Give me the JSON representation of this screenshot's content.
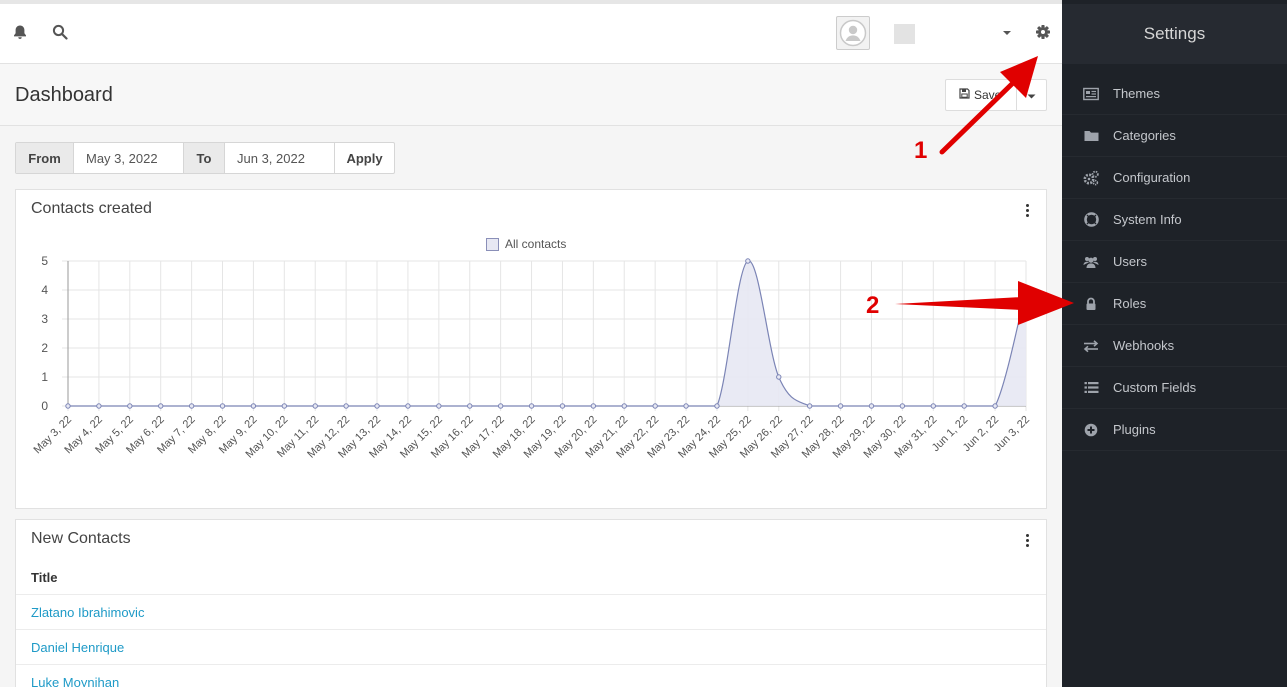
{
  "header": {
    "page_title": "Dashboard",
    "save_label": "Save"
  },
  "date_filter": {
    "from_label": "From",
    "from_value": "May 3, 2022",
    "to_label": "To",
    "to_value": "Jun 3, 2022",
    "apply_label": "Apply"
  },
  "contacts_panel": {
    "title": "Contacts created"
  },
  "chart_data": {
    "type": "area",
    "legend_position": "top-center",
    "grid": true,
    "ylim": [
      0,
      5
    ],
    "yticks": [
      0,
      1,
      2,
      3,
      4,
      5
    ],
    "series": [
      {
        "name": "All contacts",
        "color": "#7b84b5",
        "fill": "#e7e8f3",
        "values": [
          0,
          0,
          0,
          0,
          0,
          0,
          0,
          0,
          0,
          0,
          0,
          0,
          0,
          0,
          0,
          0,
          0,
          0,
          0,
          0,
          0,
          0,
          5,
          1,
          0,
          0,
          0,
          0,
          0,
          0,
          0,
          4
        ]
      }
    ],
    "categories": [
      "May 3, 22",
      "May 4, 22",
      "May 5, 22",
      "May 6, 22",
      "May 7, 22",
      "May 8, 22",
      "May 9, 22",
      "May 10, 22",
      "May 11, 22",
      "May 12, 22",
      "May 13, 22",
      "May 14, 22",
      "May 15, 22",
      "May 16, 22",
      "May 17, 22",
      "May 18, 22",
      "May 19, 22",
      "May 20, 22",
      "May 21, 22",
      "May 22, 22",
      "May 23, 22",
      "May 24, 22",
      "May 25, 22",
      "May 26, 22",
      "May 27, 22",
      "May 28, 22",
      "May 29, 22",
      "May 30, 22",
      "May 31, 22",
      "Jun 1, 22",
      "Jun 2, 22",
      "Jun 3, 22"
    ]
  },
  "new_contacts": {
    "title": "New Contacts",
    "column": "Title",
    "rows": [
      "Zlatano Ibrahimovic",
      "Daniel Henrique",
      "Luke Moynihan"
    ]
  },
  "sidebar": {
    "title": "Settings",
    "items": [
      {
        "label": "Themes",
        "icon": "themes-icon"
      },
      {
        "label": "Categories",
        "icon": "folder-icon"
      },
      {
        "label": "Configuration",
        "icon": "cogs-icon"
      },
      {
        "label": "System Info",
        "icon": "lifebuoy-icon"
      },
      {
        "label": "Users",
        "icon": "users-icon"
      },
      {
        "label": "Roles",
        "icon": "lock-icon"
      },
      {
        "label": "Webhooks",
        "icon": "exchange-icon"
      },
      {
        "label": "Custom Fields",
        "icon": "list-icon"
      },
      {
        "label": "Plugins",
        "icon": "plus-circle-icon"
      }
    ]
  },
  "annotations": {
    "arrow_1_label": "1",
    "arrow_2_label": "2",
    "color": "#e00000"
  }
}
